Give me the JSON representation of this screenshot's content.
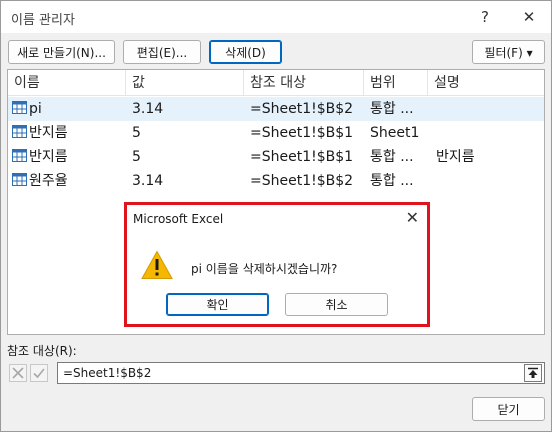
{
  "window": {
    "title": "이름 관리자",
    "help_glyph": "?",
    "close_glyph": "✕"
  },
  "toolbar": {
    "new_label": "새로 만들기(N)...",
    "edit_label": "편집(E)...",
    "delete_label": "삭제(D)",
    "filter_label": "필터(F) ▾"
  },
  "table": {
    "headers": [
      "이름",
      "값",
      "참조 대상",
      "범위",
      "설명"
    ],
    "rows": [
      {
        "name": "pi",
        "value": "3.14",
        "ref": "=Sheet1!$B$2",
        "scope": "통합 ...",
        "desc": ""
      },
      {
        "name": "반지름",
        "value": "5",
        "ref": "=Sheet1!$B$1",
        "scope": "Sheet1",
        "desc": ""
      },
      {
        "name": "반지름",
        "value": "5",
        "ref": "=Sheet1!$B$1",
        "scope": "통합 ...",
        "desc": "반지름"
      },
      {
        "name": "원주율",
        "value": "3.14",
        "ref": "=Sheet1!$B$2",
        "scope": "통합 ...",
        "desc": ""
      }
    ]
  },
  "refers_to": {
    "label": "참조 대상(R):",
    "value": "=Sheet1!$B$2"
  },
  "footer": {
    "close_label": "닫기"
  },
  "dialog": {
    "title": "Microsoft Excel",
    "close_glyph": "✕",
    "message": "pi 이름을 삭제하시겠습니까?",
    "ok_label": "확인",
    "cancel_label": "취소"
  },
  "colors": {
    "highlight_border": "#e0131c",
    "accent": "#0067c0",
    "selected_row": "#e5f1fb"
  },
  "icons": {
    "name_icon": "named-range-icon",
    "warning_icon": "warning-icon"
  }
}
